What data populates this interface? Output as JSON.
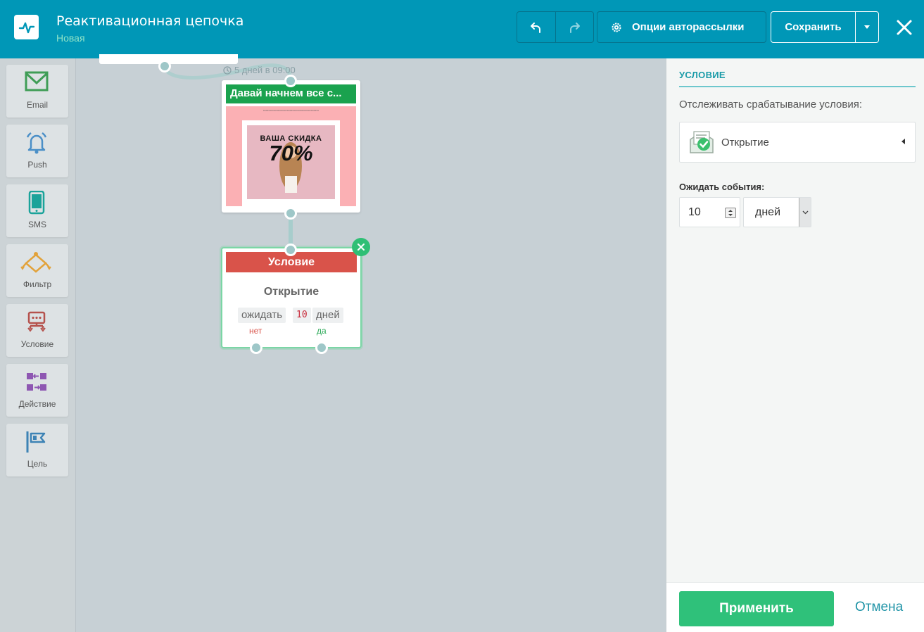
{
  "header": {
    "title": "Реактивационная цепочка",
    "status": "Новая",
    "options_label": "Опции авторассылки",
    "save_label": "Сохранить"
  },
  "palette": {
    "items": [
      {
        "label": "Email",
        "icon": "email-icon",
        "color": "#3f9d56"
      },
      {
        "label": "Push",
        "icon": "bell-icon",
        "color": "#4b8fc7"
      },
      {
        "label": "SMS",
        "icon": "phone-icon",
        "color": "#1aa39a"
      },
      {
        "label": "Фильтр",
        "icon": "filter-icon",
        "color": "#e2a23a"
      },
      {
        "label": "Условие",
        "icon": "condition-icon",
        "color": "#b5524d"
      },
      {
        "label": "Действие",
        "icon": "action-icon",
        "color": "#8e57b2"
      },
      {
        "label": "Цель",
        "icon": "goal-flag-icon",
        "color": "#3d83b5"
      }
    ]
  },
  "canvas": {
    "timer_label": "5 дней в 09:00",
    "email_node": {
      "title": "Давай начнем все с...",
      "preview_line1": "ВАША СКИДКА",
      "preview_line2": "70%"
    },
    "condition_node": {
      "header": "Условие",
      "event": "Открытие",
      "wait_word": "ожидать",
      "wait_value": "10",
      "wait_unit": "дней",
      "no_label": "нет",
      "yes_label": "да"
    }
  },
  "panel": {
    "section_title": "УСЛОВИЕ",
    "track_label": "Отслеживать срабатывание условия:",
    "event_value": "Открытие",
    "wait_label": "Ожидать события:",
    "wait_value": "10",
    "wait_unit": "дней",
    "apply_label": "Применить",
    "cancel_label": "Отмена"
  },
  "colors": {
    "header_bg": "#0097b7",
    "email_header": "#1aa24e",
    "condition_header": "#d9534a",
    "apply_button": "#2fc17a",
    "accent": "#1a9ba8"
  }
}
